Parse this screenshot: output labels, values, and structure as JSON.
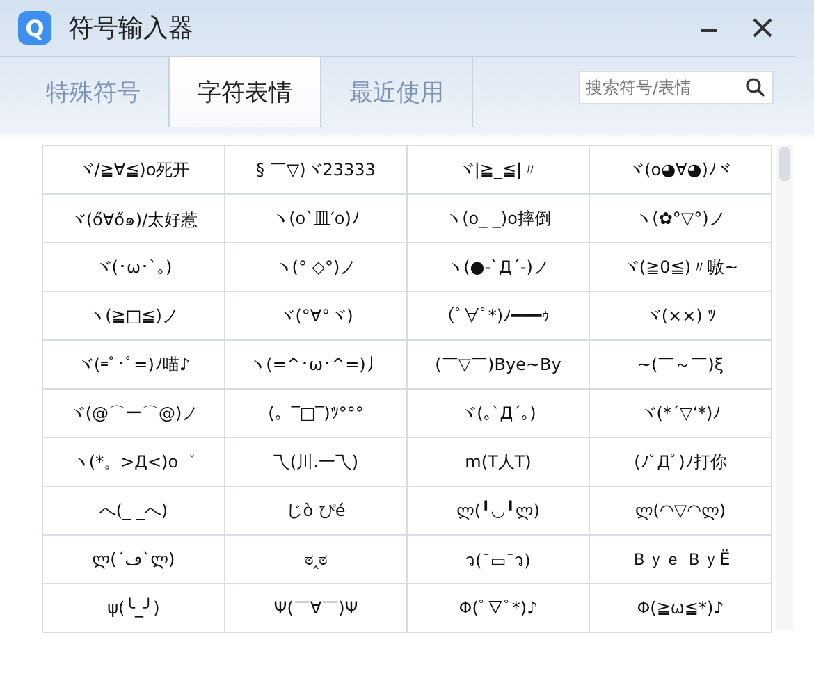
{
  "window": {
    "title": "符号输入器",
    "logo": "Q"
  },
  "tabs": [
    {
      "label": "特殊符号",
      "selected": false
    },
    {
      "label": "字符表情",
      "selected": true
    },
    {
      "label": "最近使用",
      "selected": false
    }
  ],
  "search": {
    "placeholder": "搜索符号/表情"
  },
  "grid": [
    [
      "ヾ/≧∀≦)o死开",
      "§ ￣▽)ヾ23333",
      "ヾ|≧_≦|〃",
      "ヾ(o◕∀◕)ﾉヾ"
    ],
    [
      "ヾ(ő∀ő๑)/太好惹",
      "ヽ(o`皿′o)ﾉ",
      "ヽ(o_ _)o摔倒",
      "ヽ(✿°▽°)ノ"
    ],
    [
      "ヾ(･ω･`｡)",
      "ヽ(° ◇°)ノ",
      "ヽ(●-`Д´-)ノ",
      "ヾ(≧0≦)〃嗷~"
    ],
    [
      "ヽ(≧□≦)ノ",
      "ヾ(°∀°ヾ)",
      "(ﾟ∀ﾟ*)ﾉ━━━ｩ",
      "ヾ(××) ﾂ"
    ],
    [
      "ヾ(=ﾟ･ﾟ=)ﾉ喵♪",
      "ヽ(=^･ω･^=)丿",
      "(￣▽￣)Bye~By",
      "~(￣～￣)ξ"
    ],
    [
      "ヾ(@⌒ー⌒@)ノ",
      "(。‾□‾)ﾂ°°°",
      "ヾ(｡`Д´｡)",
      "ヾ(*´▽‘*)ﾉ"
    ],
    [
      "ヽ(*。>Д<)o゜",
      "乁(川.一乁)",
      "m(T人T)",
      "(ﾉﾟДﾟ)ﾉ打你"
    ],
    [
      "へ(_ _へ)",
      "じò ぴé",
      "ლ(╹◡╹ლ)",
      "ლ(◠▽◠ლ)"
    ],
    [
      "ლ(´ڡ`ლ)",
      "ಠ‸ಠ",
      "ว(¯▭¯ว)",
      "Ｂｙｅ ＢｙЁ"
    ],
    [
      "ψ(╰_╯)",
      "Ψ(￣∀￣)Ψ",
      "Φ(ﾟ▽ﾟ*)♪",
      "Φ(≧ω≦*)♪"
    ]
  ]
}
